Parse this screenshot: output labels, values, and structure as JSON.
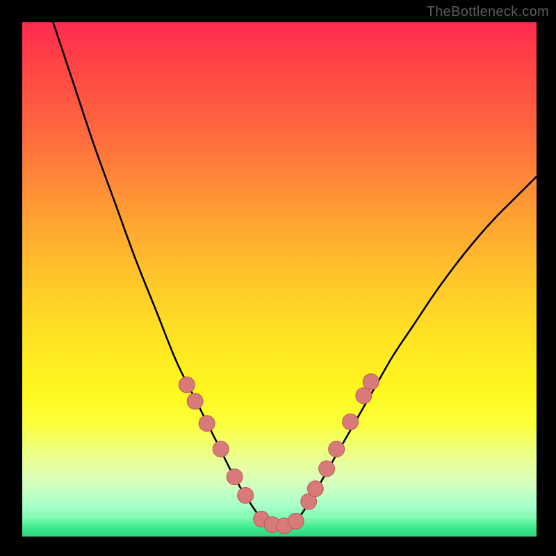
{
  "watermark": "TheBottleneck.com",
  "colors": {
    "background": "#000000",
    "curve": "#000000",
    "marker_fill": "#d97a7a",
    "marker_stroke": "#b85a5a",
    "gradient_top": "#ff2a4f",
    "gradient_bottom": "#2bd77c"
  },
  "chart_data": {
    "type": "line",
    "title": "",
    "xlabel": "",
    "ylabel": "",
    "xlim": [
      0,
      100
    ],
    "ylim": [
      0,
      100
    ],
    "note": "Axes are unlabeled in the source image; values are percentage positions in the 740x740 plot area (0,0 top-left).",
    "series": [
      {
        "name": "bottleneck-curve",
        "x": [
          6,
          10,
          14,
          18,
          22,
          26,
          30,
          34,
          38,
          41,
          44,
          46.5,
          48.5,
          50,
          52,
          54,
          56,
          60,
          64,
          68,
          72,
          76,
          80,
          84,
          88,
          92,
          96,
          100
        ],
        "y": [
          0,
          12,
          24,
          35,
          46,
          56,
          66,
          74,
          82,
          88,
          93,
          96.5,
          98,
          98.5,
          98,
          96,
          93,
          86,
          79,
          72,
          65,
          59,
          53,
          47.5,
          42.5,
          38,
          34,
          30
        ]
      }
    ],
    "markers": [
      {
        "name": "left-1",
        "x": 32.0,
        "y": 70.5
      },
      {
        "name": "left-2",
        "x": 33.6,
        "y": 73.7
      },
      {
        "name": "left-3",
        "x": 35.9,
        "y": 78.0
      },
      {
        "name": "left-4",
        "x": 38.6,
        "y": 83.0
      },
      {
        "name": "left-5",
        "x": 41.3,
        "y": 88.4
      },
      {
        "name": "left-6",
        "x": 43.4,
        "y": 92.0
      },
      {
        "name": "flat-1",
        "x": 46.5,
        "y": 96.6
      },
      {
        "name": "flat-2",
        "x": 48.6,
        "y": 97.7
      },
      {
        "name": "flat-3",
        "x": 51.0,
        "y": 97.9
      },
      {
        "name": "flat-4",
        "x": 53.2,
        "y": 97.0
      },
      {
        "name": "right-1",
        "x": 55.7,
        "y": 93.2
      },
      {
        "name": "right-2",
        "x": 57.0,
        "y": 90.7
      },
      {
        "name": "right-3",
        "x": 59.2,
        "y": 86.8
      },
      {
        "name": "right-4",
        "x": 61.1,
        "y": 83.0
      },
      {
        "name": "right-5",
        "x": 63.8,
        "y": 77.7
      },
      {
        "name": "right-6",
        "x": 66.4,
        "y": 72.6
      },
      {
        "name": "right-7",
        "x": 67.8,
        "y": 69.9
      }
    ],
    "marker_radius_percent": 1.55
  }
}
